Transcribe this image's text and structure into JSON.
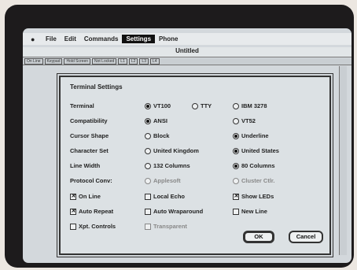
{
  "menubar": {
    "apple": "●",
    "items": [
      "File",
      "Edit",
      "Commands",
      "Settings",
      "Phone"
    ],
    "active": "Settings"
  },
  "window": {
    "title": "Untitled"
  },
  "statusbar": {
    "fields": [
      "On Line",
      "Keypad",
      "Hold Screen",
      "Not Locked",
      "L1",
      "L2",
      "L3",
      "L4"
    ]
  },
  "dialog": {
    "title": "Terminal Settings",
    "rows": [
      {
        "label": "Terminal",
        "options": [
          {
            "text": "VT100",
            "selected": true
          },
          {
            "text": "TTY",
            "selected": false
          },
          {
            "text": "IBM 3278",
            "selected": false
          }
        ]
      },
      {
        "label": "Compatibility",
        "options": [
          {
            "text": "ANSI",
            "selected": true
          },
          {
            "text": "VT52",
            "selected": false
          }
        ]
      },
      {
        "label": "Cursor Shape",
        "options": [
          {
            "text": "Block",
            "selected": false
          },
          {
            "text": "Underline",
            "selected": true
          }
        ]
      },
      {
        "label": "Character Set",
        "options": [
          {
            "text": "United Kingdom",
            "selected": false
          },
          {
            "text": "United States",
            "selected": true
          }
        ]
      },
      {
        "label": "Line Width",
        "options": [
          {
            "text": "132 Columns",
            "selected": false
          },
          {
            "text": "80 Columns",
            "selected": true
          }
        ]
      },
      {
        "label": "Protocol Conv:",
        "options": [
          {
            "text": "Applesoft",
            "selected": false
          },
          {
            "text": "Cluster Ctlr.",
            "selected": false
          }
        ]
      }
    ],
    "checkboxes": [
      [
        {
          "text": "On Line",
          "checked": true
        },
        {
          "text": "Local Echo",
          "checked": false
        },
        {
          "text": "Show LEDs",
          "checked": true
        }
      ],
      [
        {
          "text": "Auto Repeat",
          "checked": true
        },
        {
          "text": "Auto Wraparound",
          "checked": false
        },
        {
          "text": "New Line",
          "checked": false
        }
      ],
      [
        {
          "text": "Xpt. Controls",
          "checked": false
        },
        {
          "text": "Transparent",
          "checked": false
        }
      ]
    ],
    "ok_label": "OK",
    "cancel_label": "Cancel"
  }
}
